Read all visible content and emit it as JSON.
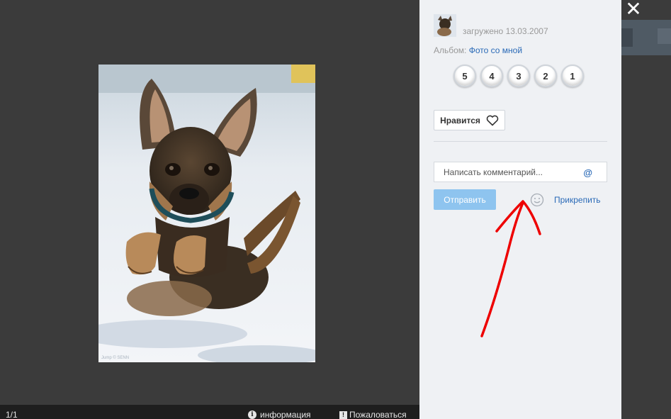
{
  "viewer": {
    "counter": "1/1",
    "info_label": "информация",
    "report_label": "Пожаловаться",
    "photo_credit": "Jump © SENN",
    "close_glyph": "✕"
  },
  "panel": {
    "uploaded_text": "загружено 13.03.2007",
    "album_label": "Альбом:",
    "album_name": "Фото со мной",
    "rating": [
      "5",
      "4",
      "3",
      "2",
      "1"
    ],
    "like_label": "Нравится",
    "comment_placeholder": "Написать комментарий...",
    "mention_symbol": "@",
    "send_label": "Отправить",
    "attach_label": "Прикрепить"
  },
  "colors": {
    "panel_bg": "#eff1f4",
    "viewer_bg": "#3b3b3b",
    "link": "#2a6ab7",
    "send_button": "#8ec4ef",
    "annotation_arrow": "#ee0000"
  }
}
